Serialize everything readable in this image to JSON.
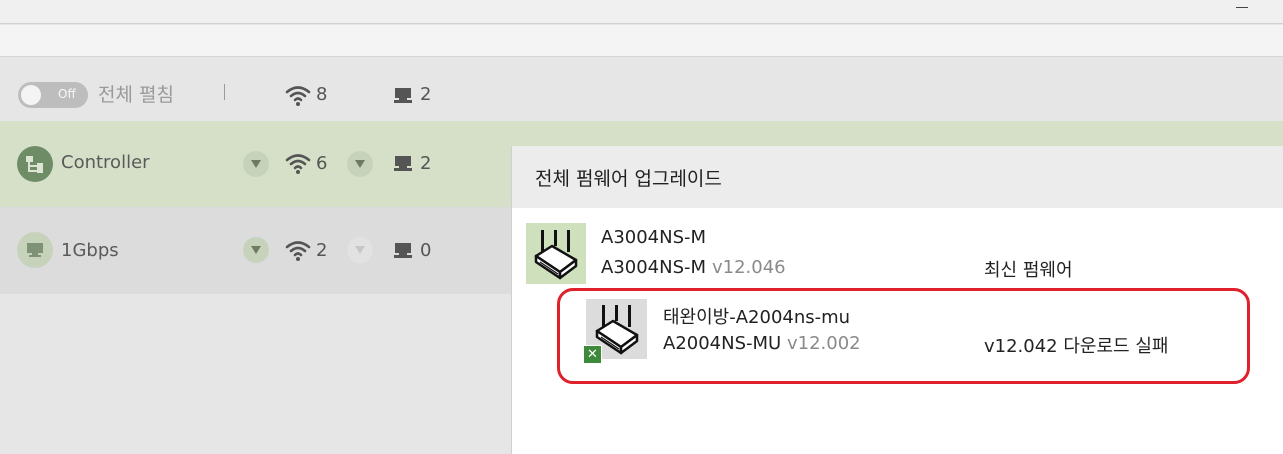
{
  "summary": {
    "toggle_label": "Off",
    "expand_all_label": "전체 펼침",
    "wifi_count": "8",
    "wired_count": "2"
  },
  "groups": [
    {
      "name": "Controller",
      "wifi_count": "6",
      "wired_count": "2"
    },
    {
      "name": "1Gbps",
      "wifi_count": "2",
      "wired_count": "0"
    }
  ],
  "panel": {
    "title": "전체 펌웨어 업그레이드",
    "devices": [
      {
        "name": "A3004NS-M",
        "model": "A3004NS-M",
        "version": "v12.046",
        "status": "최신 펌웨어"
      },
      {
        "name": "태완이방-A2004ns-mu",
        "model": "A2004NS-MU",
        "version": "v12.002",
        "status": "v12.042 다운로드 실패"
      }
    ]
  },
  "colors": {
    "controller_row": "#d6e0c8",
    "highlight_border": "#e0202a",
    "error_badge": "#3e8a3a"
  }
}
